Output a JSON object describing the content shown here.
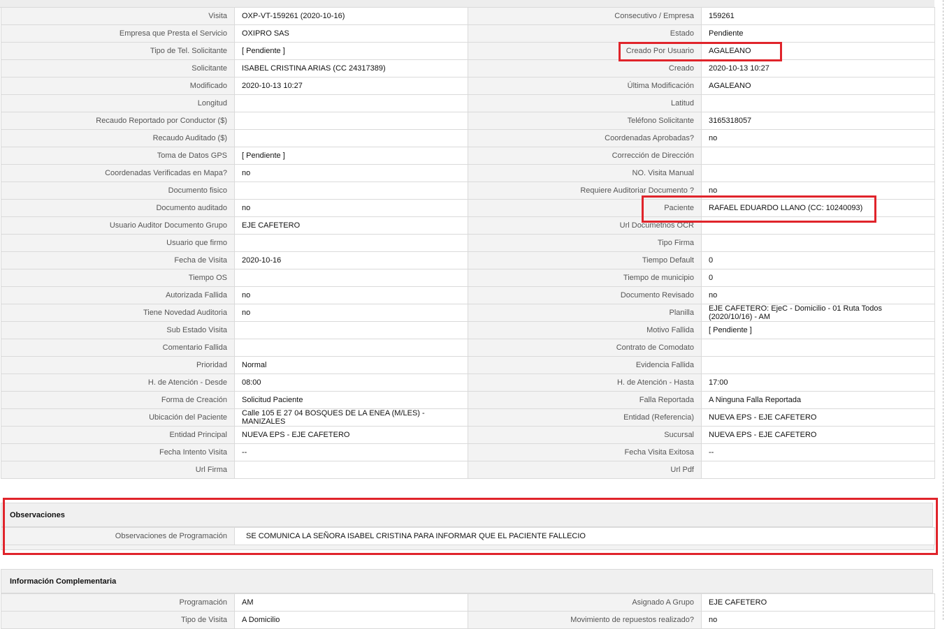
{
  "details": {
    "rows": [
      {
        "l1": "Visita",
        "v1": "OXP-VT-159261 (2020-10-16)",
        "l2": "Consecutivo / Empresa",
        "v2": "159261"
      },
      {
        "l1": "Empresa que Presta el Servicio",
        "v1": "OXIPRO SAS",
        "l2": "Estado",
        "v2": "Pendiente"
      },
      {
        "l1": "Tipo de Tel. Solicitante",
        "v1": "[ Pendiente ]",
        "l2": "Creado Por Usuario",
        "v2": "AGALEANO"
      },
      {
        "l1": "Solicitante",
        "v1": "ISABEL CRISTINA ARIAS (CC 24317389)",
        "l2": "Creado",
        "v2": "2020-10-13 10:27"
      },
      {
        "l1": "Modificado",
        "v1": "2020-10-13 10:27",
        "l2": "Última Modificación",
        "v2": " AGALEANO"
      },
      {
        "l1": "Longitud",
        "v1": "",
        "l2": "Latitud",
        "v2": ""
      },
      {
        "l1": "Recaudo Reportado por Conductor ($)",
        "v1": "",
        "l2": "Teléfono Solicitante",
        "v2": "3165318057"
      },
      {
        "l1": "Recaudo Auditado ($)",
        "v1": "",
        "l2": "Coordenadas Aprobadas?",
        "v2": " no"
      },
      {
        "l1": "Toma de Datos GPS",
        "v1": "[ Pendiente ]",
        "l2": "Corrección de Dirección",
        "v2": ""
      },
      {
        "l1": "Coordenadas Verificadas en Mapa?",
        "v1": " no",
        "l2": "NO. Visita Manual",
        "v2": ""
      },
      {
        "l1": "Documento fisico",
        "v1": "",
        "l2": "Requiere Auditoriar Documento ?",
        "v2": " no"
      },
      {
        "l1": "Documento auditado",
        "v1": " no",
        "l2": "Paciente",
        "v2": "RAFAEL EDUARDO LLANO (CC: 10240093)"
      },
      {
        "l1": "Usuario Auditor Documento Grupo",
        "v1": "EJE CAFETERO",
        "l2": "Url Documetnos OCR",
        "v2": ""
      },
      {
        "l1": "Usuario que firmo",
        "v1": "",
        "l2": "Tipo Firma",
        "v2": ""
      },
      {
        "l1": "Fecha de Visita",
        "v1": " 2020-10-16",
        "l2": "Tiempo Default",
        "v2": "0"
      },
      {
        "l1": "Tiempo OS",
        "v1": "",
        "l2": "Tiempo de municipio",
        "v2": "0"
      },
      {
        "l1": "Autorizada Fallida",
        "v1": " no",
        "l2": "Documento Revisado",
        "v2": " no"
      },
      {
        "l1": "Tiene Novedad Auditoria",
        "v1": " no",
        "l2": "Planilla",
        "v2": "EJE CAFETERO: EjeC - Domicilio - 01 Ruta Todos (2020/10/16) - AM"
      },
      {
        "l1": "Sub Estado Visita",
        "v1": "",
        "l2": "Motivo Fallida",
        "v2": "[ Pendiente ]"
      },
      {
        "l1": "Comentario Fallida",
        "v1": "",
        "l2": "Contrato de Comodato",
        "v2": ""
      },
      {
        "l1": "Prioridad",
        "v1": "Normal",
        "l2": "Evidencia Fallida",
        "v2": ""
      },
      {
        "l1": "H. de Atención - Desde",
        "v1": "08:00",
        "l2": "H. de Atención - Hasta",
        "v2": "17:00"
      },
      {
        "l1": "Forma de Creación",
        "v1": "Solicitud Paciente",
        "l2": "Falla Reportada",
        "v2": "A Ninguna Falla Reportada"
      },
      {
        "l1": "Ubicación del Paciente",
        "v1": "Calle 105 E 27 04 BOSQUES DE LA ENEA (M/LES) - MANIZALES",
        "l2": "Entidad (Referencia)",
        "v2": "NUEVA EPS - EJE CAFETERO"
      },
      {
        "l1": "Entidad Principal",
        "v1": "NUEVA EPS - EJE CAFETERO",
        "l2": "Sucursal",
        "v2": "NUEVA EPS - EJE CAFETERO"
      },
      {
        "l1": "Fecha Intento Visita",
        "v1": " --",
        "l2": "Fecha Visita Exitosa",
        "v2": " --"
      },
      {
        "l1": "Url Firma",
        "v1": "",
        "l2": "Url Pdf",
        "v2": ""
      }
    ]
  },
  "observaciones": {
    "title": "Observaciones",
    "label": "Observaciones de Programación",
    "value": "SE COMUNICA LA SEÑORA ISABEL CRISTINA PARA INFORMAR QUE EL PACIENTE FALLECIO"
  },
  "complementaria": {
    "title": "Información Complementaria",
    "rows": [
      {
        "l1": "Programación",
        "v1": "AM",
        "l2": "Asignado A Grupo",
        "v2": "EJE CAFETERO"
      },
      {
        "l1": "Tipo de Visita",
        "v1": "A Domicilio",
        "l2": "Movimiento de repuestos realizado?",
        "v2": " no"
      }
    ]
  },
  "colors": {
    "highlight": "#e0242b",
    "label_bg": "#f3f3f3",
    "border": "#dadada"
  }
}
